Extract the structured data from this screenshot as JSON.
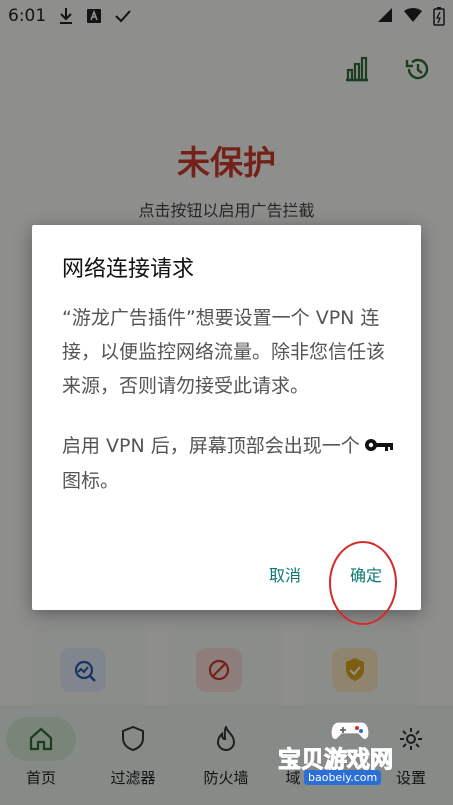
{
  "status_bar": {
    "time": "6:01"
  },
  "main": {
    "title": "未保护",
    "subtitle": "点击按钮以启用广告拦截"
  },
  "dialog": {
    "title": "网络连接请求",
    "paragraph1": "“游龙广告插件”想要设置一个 VPN 连接，以便监控网络流量。除非您信任该来源，否则请勿接受此请求。",
    "paragraph2_before": "启用 VPN 后，屏幕顶部会出现一个",
    "paragraph2_after": "图标。",
    "cancel_label": "取消",
    "ok_label": "确定"
  },
  "bottom_nav": {
    "items": [
      {
        "label": "首页"
      },
      {
        "label": "过滤器"
      },
      {
        "label": "防火墙"
      },
      {
        "label": "域"
      },
      {
        "label": "设置"
      }
    ]
  },
  "watermark": {
    "text": "宝贝游戏网",
    "url": "baobeiy.com"
  },
  "colors": {
    "accent": "#0c7a72",
    "danger": "#c83a2b",
    "annotation": "#d62b2b"
  }
}
